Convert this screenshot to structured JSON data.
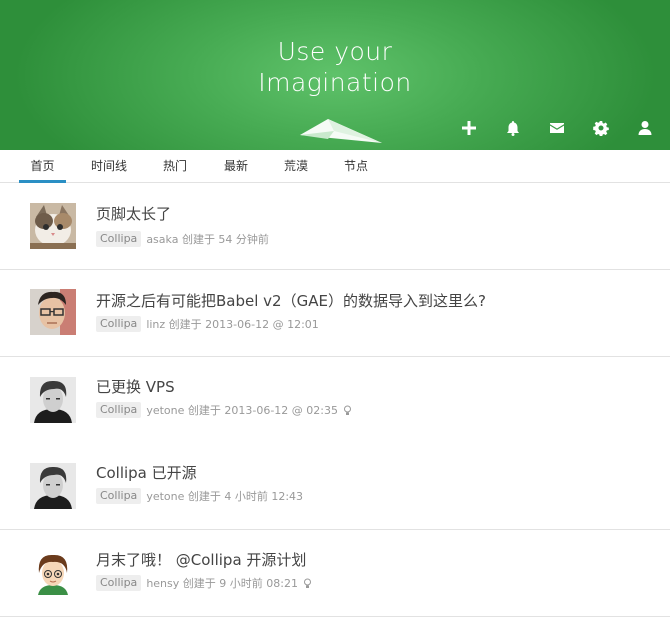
{
  "header": {
    "tagline_line1": "Use your",
    "tagline_line2": "Imagination",
    "icons": [
      "plus-icon",
      "bell-icon",
      "mail-icon",
      "gear-icon",
      "user-icon"
    ],
    "background_color": "#47ab53"
  },
  "tabs": [
    {
      "label": "首页",
      "active": true
    },
    {
      "label": "时间线",
      "active": false
    },
    {
      "label": "热门",
      "active": false
    },
    {
      "label": "最新",
      "active": false
    },
    {
      "label": "荒漠",
      "active": false
    },
    {
      "label": "节点",
      "active": false
    }
  ],
  "accent_color": "#2a8fc4",
  "topics": [
    {
      "title": "页脚太长了",
      "node": "Collipa",
      "meta": "asaka 创建于 54 分钟前",
      "has_bulb": false,
      "avatar": "cat-avatar"
    },
    {
      "title": "开源之后有可能把Babel v2（GAE）的数据导入到这里么?",
      "node": "Collipa",
      "meta": "linz 创建于 2013-06-12 @ 12:01",
      "has_bulb": false,
      "avatar": "glasses-man-avatar"
    },
    {
      "title": "已更换 VPS",
      "node": "Collipa",
      "meta": "yetone 创建于 2013-06-12 @ 02:35",
      "has_bulb": true,
      "avatar": "bw-man-avatar"
    },
    {
      "title": "Collipa 已开源",
      "node": "Collipa",
      "meta": "yetone 创建于 4 小时前 12:43",
      "has_bulb": false,
      "avatar": "bw-man-avatar"
    },
    {
      "title": "月末了哦！ @Collipa 开源计划",
      "node": "Collipa",
      "meta": "hensy 创建于 9 小时前 08:21",
      "has_bulb": true,
      "avatar": "cartoon-boy-avatar"
    }
  ]
}
